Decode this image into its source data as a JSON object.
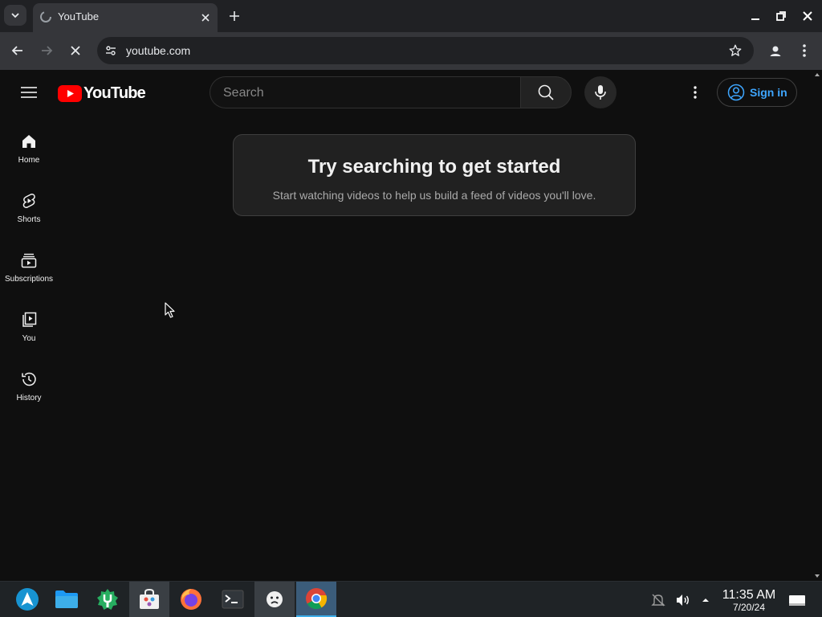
{
  "browser": {
    "tab_title": "YouTube",
    "url": "youtube.com"
  },
  "youtube": {
    "search_placeholder": "Search",
    "sign_in_label": "Sign in",
    "logo_text": "YouTube",
    "guide": [
      {
        "label": "Home",
        "icon": "home-icon"
      },
      {
        "label": "Shorts",
        "icon": "shorts-icon"
      },
      {
        "label": "Subscriptions",
        "icon": "subscriptions-icon"
      },
      {
        "label": "You",
        "icon": "you-icon"
      },
      {
        "label": "History",
        "icon": "history-icon"
      }
    ],
    "promo": {
      "title": "Try searching to get started",
      "subtitle": "Start watching videos to help us build a feed of videos you'll love."
    },
    "colors": {
      "brand_red": "#ff0000",
      "link_blue": "#3ea6ff",
      "background": "#0f0f0f"
    }
  },
  "taskbar": {
    "apps": [
      "launcher-icon",
      "files-icon",
      "settings-icon",
      "store-icon",
      "firefox-icon",
      "terminal-icon",
      "face-icon",
      "chrome-icon"
    ],
    "time": "11:35 AM",
    "date": "7/20/24"
  }
}
